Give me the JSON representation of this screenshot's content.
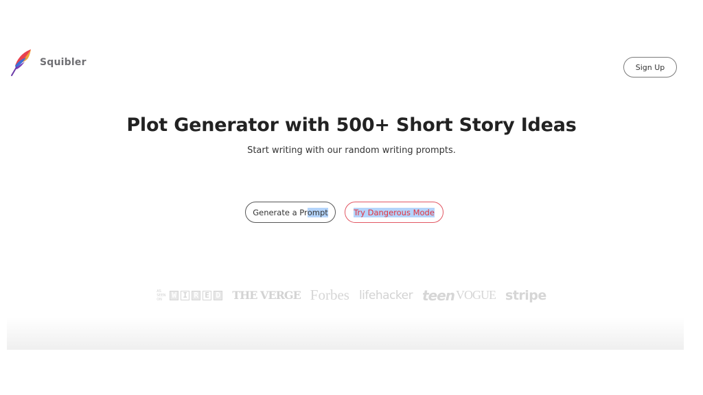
{
  "header": {
    "logo_text": "Squibler",
    "logo_icon": "feather-quill-icon",
    "signup_label": "Sign Up"
  },
  "hero": {
    "title": "Plot Generator with 500+ Short Story Ideas",
    "subtitle": "Start writing with our random writing prompts."
  },
  "actions": {
    "generate_prefix": "Generate a Pr",
    "generate_selected": "ompt",
    "danger_label": "Try Dangerous Mode"
  },
  "press": {
    "wired_prefix": "As seen on",
    "wired": [
      "W",
      "I",
      "R",
      "E",
      "D"
    ],
    "verge": "THE VERGE",
    "forbes": "Forbes",
    "lifehacker": "lifehacker",
    "teen": "teen",
    "vogue": "VOGUE",
    "stripe": "stripe"
  },
  "colors": {
    "accent_red": "#e1323f",
    "selection": "#b4d4fb",
    "logo_text": "#6f6f73"
  }
}
